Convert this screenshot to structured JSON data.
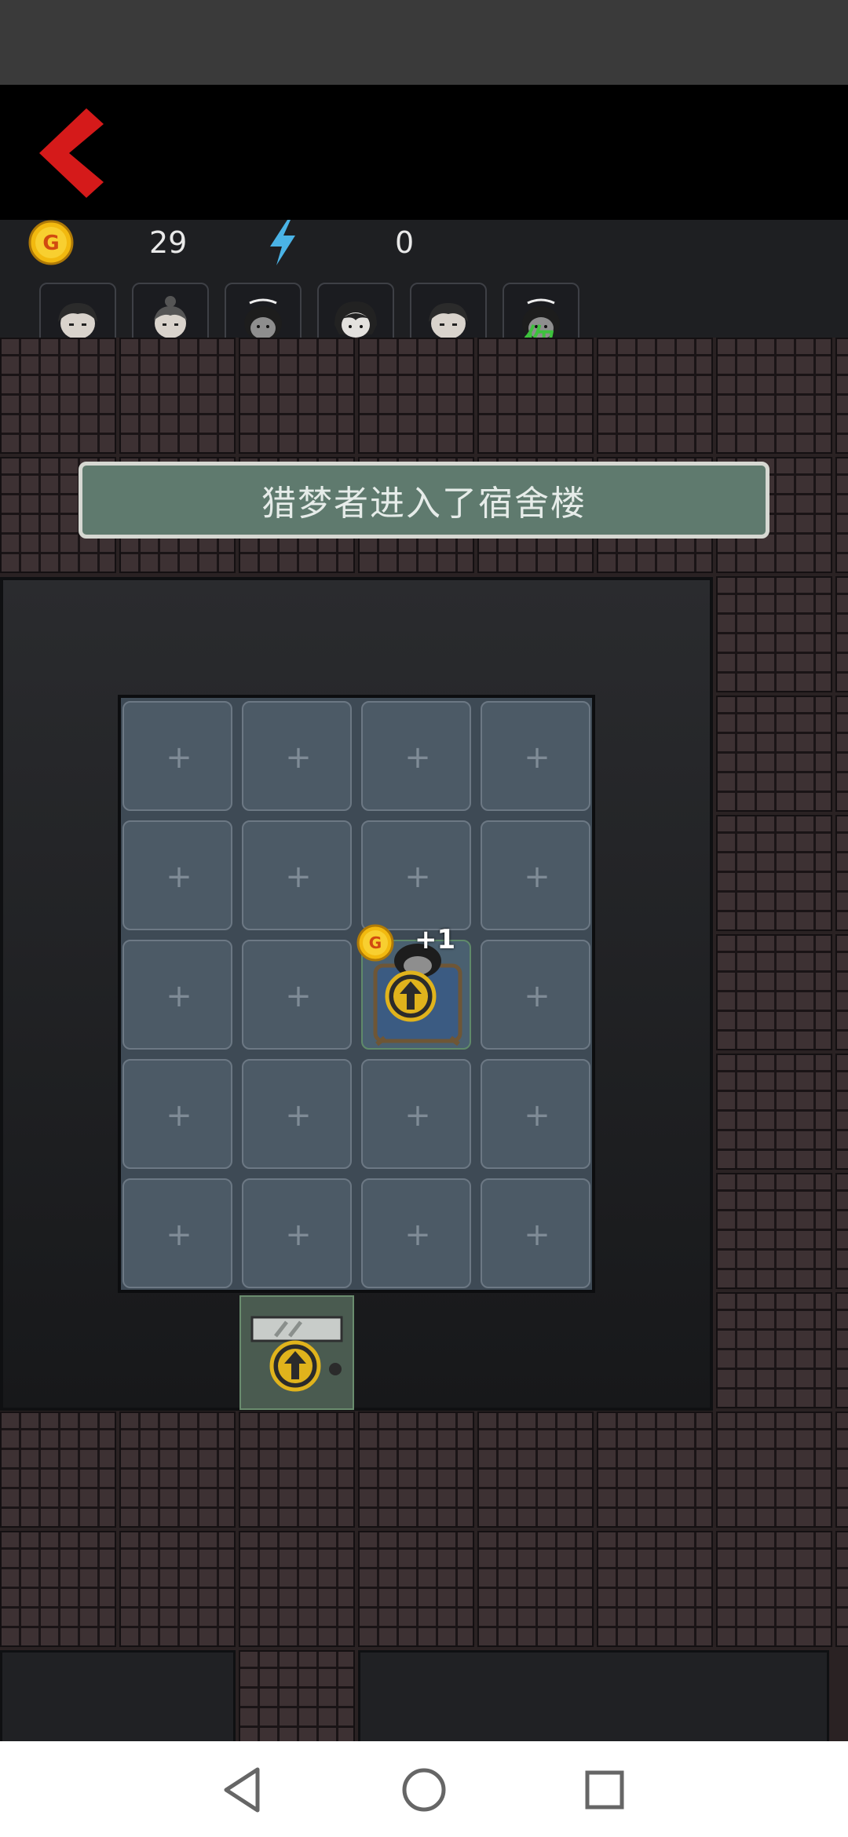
{
  "hud": {
    "coin_label": "G",
    "coins": "29",
    "energy": "0"
  },
  "players": [
    {
      "name": "player-avatar-1",
      "tag": ""
    },
    {
      "name": "player-avatar-2",
      "tag": ""
    },
    {
      "name": "player-avatar-3",
      "tag": ""
    },
    {
      "name": "player-avatar-4",
      "tag": ""
    },
    {
      "name": "player-avatar-5",
      "tag": ""
    },
    {
      "name": "player-avatar-you",
      "tag": "你"
    }
  ],
  "banner": {
    "message": "猎梦者进入了宿舍楼"
  },
  "board": {
    "cell_symbol": "+",
    "bed_reward": "+1",
    "bed_coin_label": "G"
  },
  "icons": {
    "back": "chevron-left-icon",
    "coin": "coin-icon",
    "energy": "lightning-icon",
    "upgrade": "arrow-up-circle-icon"
  },
  "colors": {
    "back_arrow": "#d51a1a",
    "coin": "#f2b90f",
    "energy": "#4ab3e6",
    "banner": "#5f7a6e",
    "you_tag": "#3ec23e"
  }
}
